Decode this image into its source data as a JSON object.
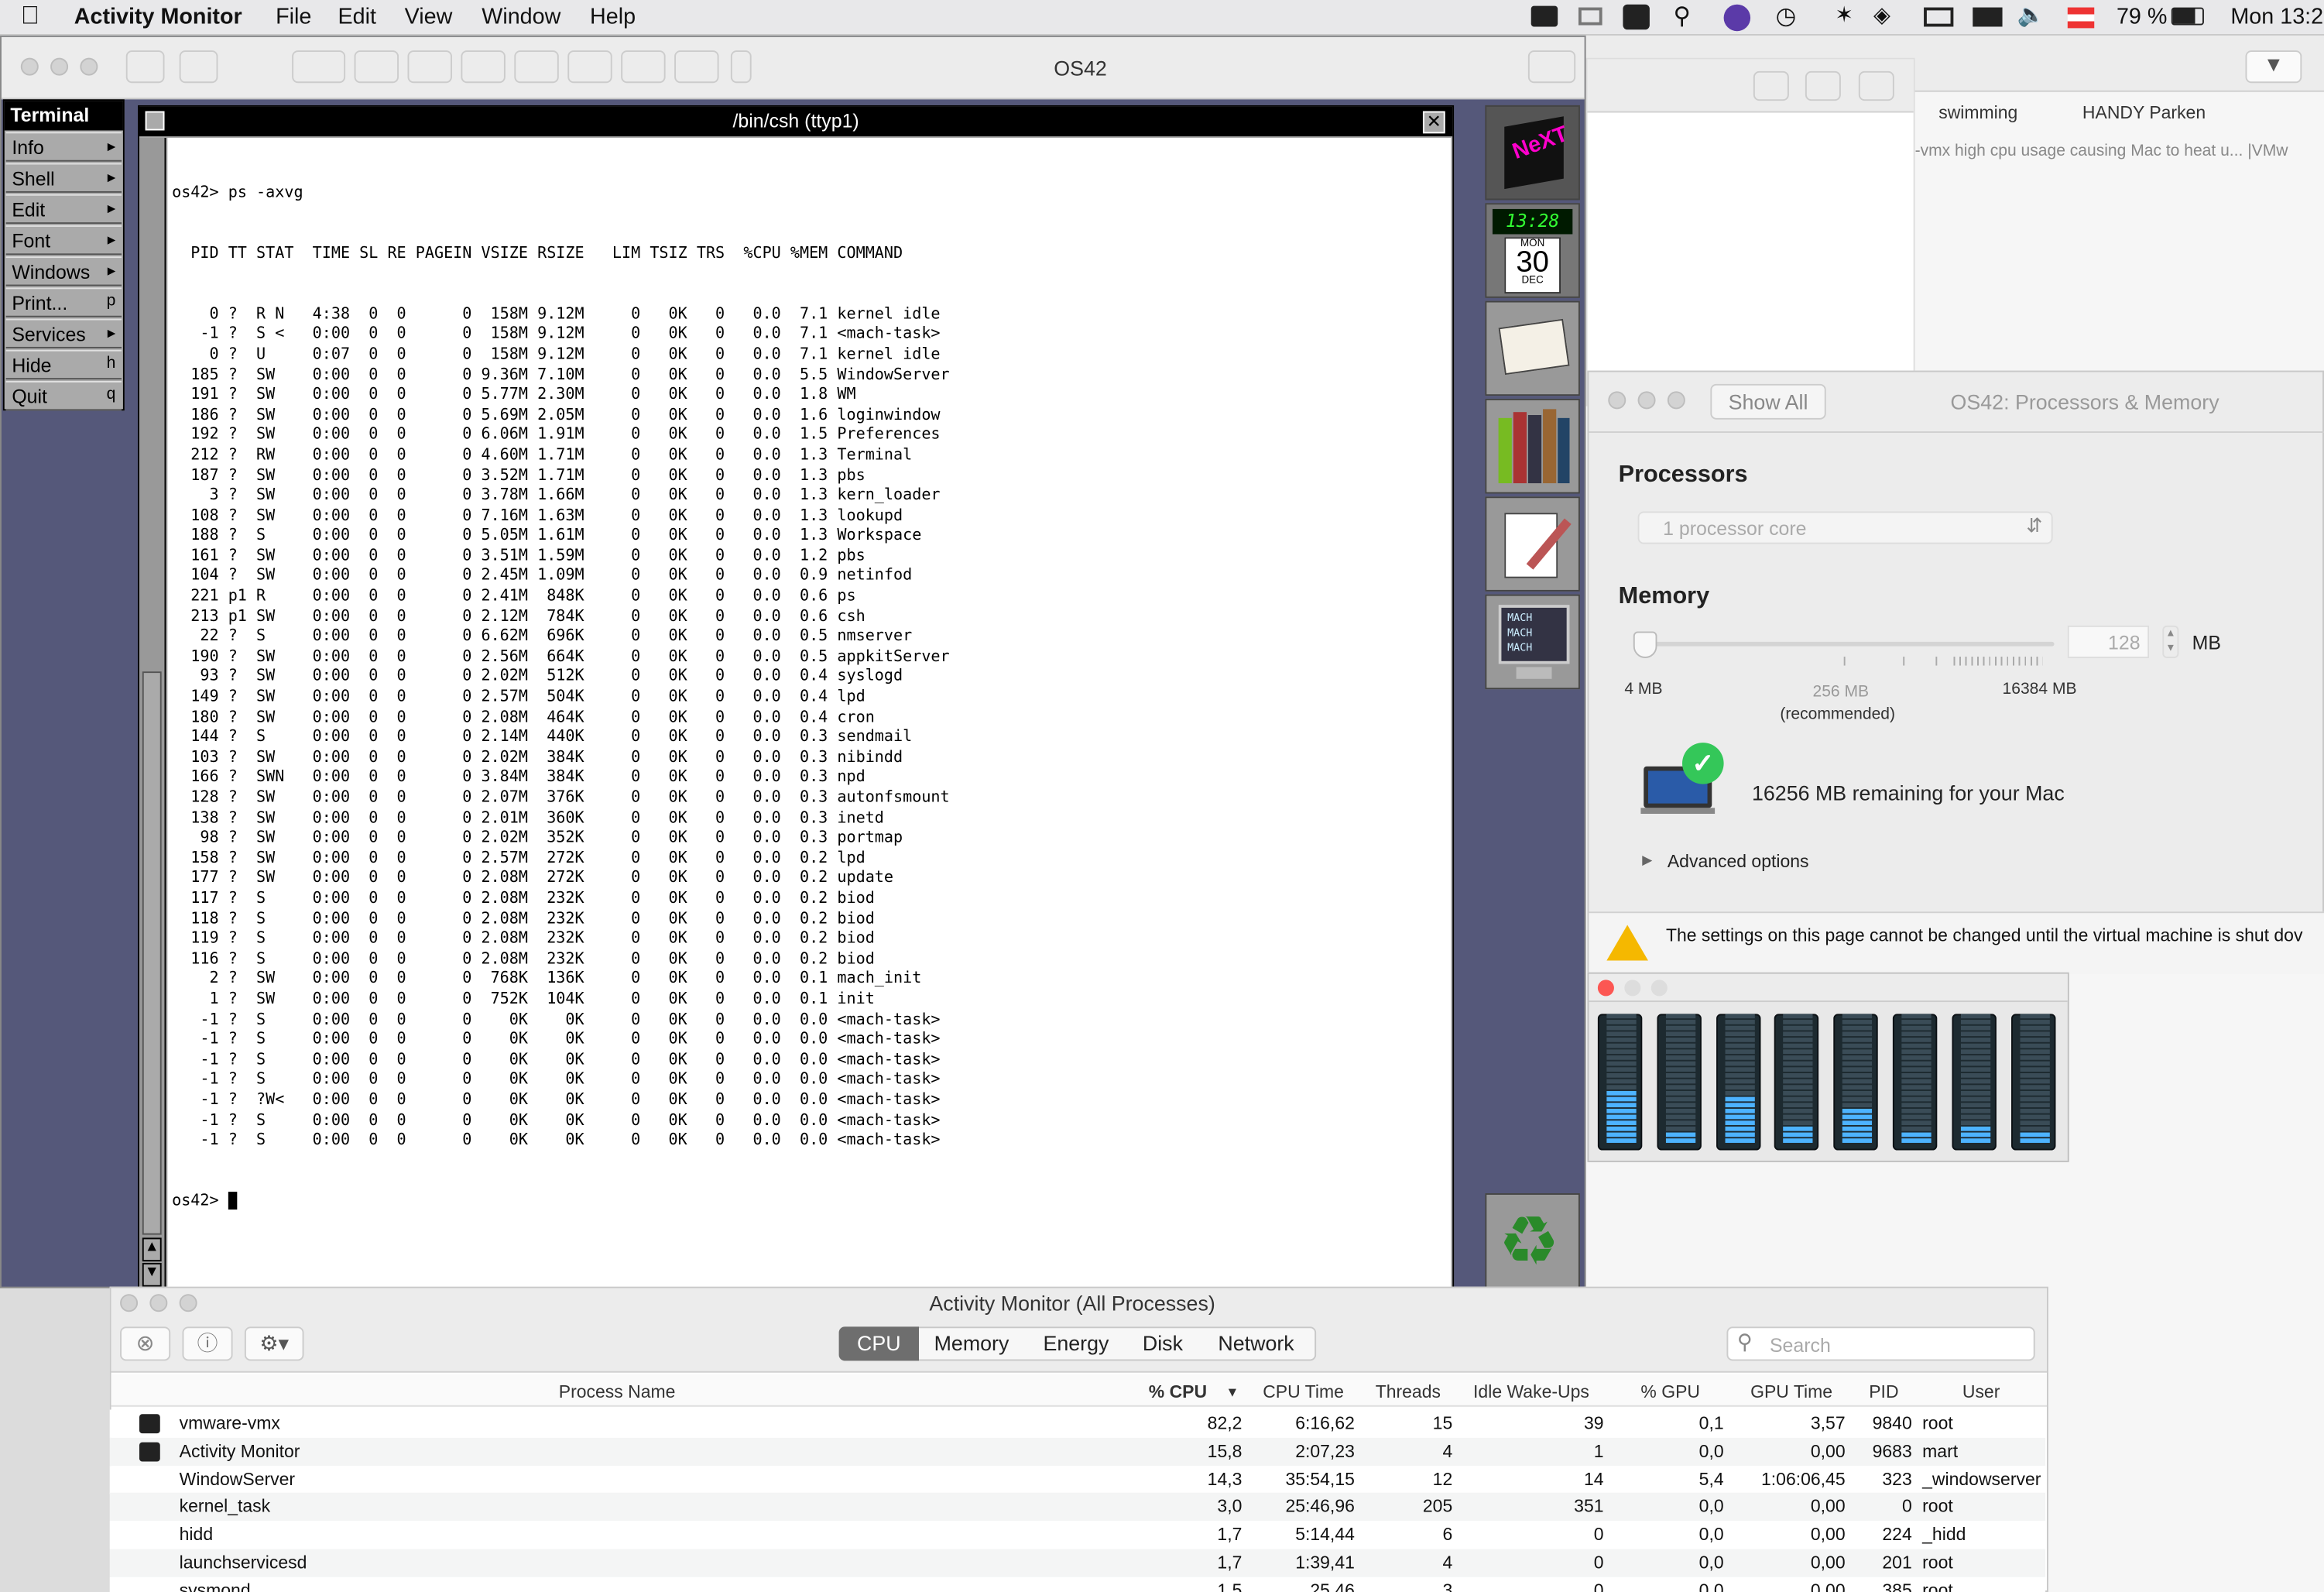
{
  "menubar": {
    "app": "Activity Monitor",
    "items": [
      "File",
      "Edit",
      "View",
      "Window",
      "Help"
    ],
    "battery": "79 %",
    "clock": "Mon 13:2"
  },
  "vm_window": {
    "title": "OS42"
  },
  "browser_bg": {
    "tab1": "swimming",
    "tab2": "HANDY Parken",
    "snippet": "-vmx high cpu usage causing Mac to heat u... |VMw"
  },
  "next_menu": {
    "title": "Terminal",
    "items": [
      {
        "label": "Info",
        "key": "▸"
      },
      {
        "label": "Shell",
        "key": "▸"
      },
      {
        "label": "Edit",
        "key": "▸"
      },
      {
        "label": "Font",
        "key": "▸"
      },
      {
        "label": "Windows",
        "key": "▸"
      },
      {
        "label": "Print...",
        "key": "p"
      },
      {
        "label": "Services",
        "key": "▸"
      },
      {
        "label": "Hide",
        "key": "h"
      },
      {
        "label": "Quit",
        "key": "q"
      }
    ]
  },
  "terminal": {
    "title": "/bin/csh (ttyp1)",
    "prompt": "os42>",
    "command": "ps -axvg",
    "header": "  PID TT STAT  TIME SL RE PAGEIN VSIZE RSIZE   LIM TSIZ TRS  %CPU %MEM COMMAND",
    "lines": [
      "    0 ?  R N   4:38  0  0      0  158M 9.12M     0   0K   0   0.0  7.1 kernel idle",
      "   -1 ?  S <   0:00  0  0      0  158M 9.12M     0   0K   0   0.0  7.1 <mach-task>",
      "    0 ?  U     0:07  0  0      0  158M 9.12M     0   0K   0   0.0  7.1 kernel idle",
      "  185 ?  SW    0:00  0  0      0 9.36M 7.10M     0   0K   0   0.0  5.5 WindowServer",
      "  191 ?  SW    0:00  0  0      0 5.77M 2.30M     0   0K   0   0.0  1.8 WM",
      "  186 ?  SW    0:00  0  0      0 5.69M 2.05M     0   0K   0   0.0  1.6 loginwindow",
      "  192 ?  SW    0:00  0  0      0 6.06M 1.91M     0   0K   0   0.0  1.5 Preferences",
      "  212 ?  RW    0:00  0  0      0 4.60M 1.71M     0   0K   0   0.0  1.3 Terminal",
      "  187 ?  SW    0:00  0  0      0 3.52M 1.71M     0   0K   0   0.0  1.3 pbs",
      "    3 ?  SW    0:00  0  0      0 3.78M 1.66M     0   0K   0   0.0  1.3 kern_loader",
      "  108 ?  SW    0:00  0  0      0 7.16M 1.63M     0   0K   0   0.0  1.3 lookupd",
      "  188 ?  S     0:00  0  0      0 5.05M 1.61M     0   0K   0   0.0  1.3 Workspace",
      "  161 ?  SW    0:00  0  0      0 3.51M 1.59M     0   0K   0   0.0  1.2 pbs",
      "  104 ?  SW    0:00  0  0      0 2.45M 1.09M     0   0K   0   0.0  0.9 netinfod",
      "  221 p1 R     0:00  0  0      0 2.41M  848K     0   0K   0   0.0  0.6 ps",
      "  213 p1 SW    0:00  0  0      0 2.12M  784K     0   0K   0   0.0  0.6 csh",
      "   22 ?  S     0:00  0  0      0 6.62M  696K     0   0K   0   0.0  0.5 nmserver",
      "  190 ?  SW    0:00  0  0      0 2.56M  664K     0   0K   0   0.0  0.5 appkitServer",
      "   93 ?  SW    0:00  0  0      0 2.02M  512K     0   0K   0   0.0  0.4 syslogd",
      "  149 ?  SW    0:00  0  0      0 2.57M  504K     0   0K   0   0.0  0.4 lpd",
      "  180 ?  SW    0:00  0  0      0 2.08M  464K     0   0K   0   0.0  0.4 cron",
      "  144 ?  S     0:00  0  0      0 2.14M  440K     0   0K   0   0.0  0.3 sendmail",
      "  103 ?  SW    0:00  0  0      0 2.02M  384K     0   0K   0   0.0  0.3 nibindd",
      "  166 ?  SWN   0:00  0  0      0 3.84M  384K     0   0K   0   0.0  0.3 npd",
      "  128 ?  SW    0:00  0  0      0 2.07M  376K     0   0K   0   0.0  0.3 autonfsmount",
      "  138 ?  SW    0:00  0  0      0 2.01M  360K     0   0K   0   0.0  0.3 inetd",
      "   98 ?  SW    0:00  0  0      0 2.02M  352K     0   0K   0   0.0  0.3 portmap",
      "  158 ?  SW    0:00  0  0      0 2.57M  272K     0   0K   0   0.0  0.2 lpd",
      "  177 ?  SW    0:00  0  0      0 2.08M  272K     0   0K   0   0.0  0.2 update",
      "  117 ?  S     0:00  0  0      0 2.08M  232K     0   0K   0   0.0  0.2 biod",
      "  118 ?  S     0:00  0  0      0 2.08M  232K     0   0K   0   0.0  0.2 biod",
      "  119 ?  S     0:00  0  0      0 2.08M  232K     0   0K   0   0.0  0.2 biod",
      "  116 ?  S     0:00  0  0      0 2.08M  232K     0   0K   0   0.0  0.2 biod",
      "    2 ?  SW    0:00  0  0      0  768K  136K     0   0K   0   0.0  0.1 mach_init",
      "    1 ?  SW    0:00  0  0      0  752K  104K     0   0K   0   0.0  0.1 init",
      "   -1 ?  S     0:00  0  0      0    0K    0K     0   0K   0   0.0  0.0 <mach-task>",
      "   -1 ?  S     0:00  0  0      0    0K    0K     0   0K   0   0.0  0.0 <mach-task>",
      "   -1 ?  S     0:00  0  0      0    0K    0K     0   0K   0   0.0  0.0 <mach-task>",
      "   -1 ?  S     0:00  0  0      0    0K    0K     0   0K   0   0.0  0.0 <mach-task>",
      "   -1 ?  ?W<   0:00  0  0      0    0K    0K     0   0K   0   0.0  0.0 <mach-task>",
      "   -1 ?  S     0:00  0  0      0    0K    0K     0   0K   0   0.0  0.0 <mach-task>",
      "   -1 ?  S     0:00  0  0      0    0K    0K     0   0K   0   0.0  0.0 <mach-task>"
    ]
  },
  "dock": {
    "clock_time": "13:28",
    "day": "MON",
    "date": "30",
    "month": "DEC",
    "mach": [
      "MACH",
      "MACH",
      "MACH"
    ]
  },
  "settings": {
    "title": "OS42: Processors & Memory",
    "show_all": "Show All",
    "processors_heading": "Processors",
    "processor_value": "1 processor core",
    "memory_heading": "Memory",
    "memory_value": "128",
    "memory_unit": "MB",
    "mem_min": "4 MB",
    "mem_rec": "256 MB",
    "mem_rec_note": "(recommended)",
    "mem_max": "16384 MB",
    "remaining": "16256 MB remaining for your Mac",
    "advanced": "Advanced options",
    "warning": "The settings on this page cannot be changed until the virtual machine is shut dov",
    "slider_fraction": 0.0
  },
  "cpu_meters": {
    "levels": [
      0.4,
      0.1,
      0.35,
      0.15,
      0.25,
      0.1,
      0.15,
      0.1
    ]
  },
  "activity": {
    "title": "Activity Monitor (All Processes)",
    "tabs": [
      "CPU",
      "Memory",
      "Energy",
      "Disk",
      "Network"
    ],
    "active_tab": "CPU",
    "search_placeholder": "Search",
    "columns": [
      "Process Name",
      "% CPU",
      "CPU Time",
      "Threads",
      "Idle Wake-Ups",
      "% GPU",
      "GPU Time",
      "PID",
      "User"
    ],
    "rows": [
      [
        "vmware-vmx",
        "82,2",
        "6:16,62",
        "15",
        "39",
        "0,1",
        "3,57",
        "9840",
        "root"
      ],
      [
        "Activity Monitor",
        "15,8",
        "2:07,23",
        "4",
        "1",
        "0,0",
        "0,00",
        "9683",
        "mart"
      ],
      [
        "WindowServer",
        "14,3",
        "35:54,15",
        "12",
        "14",
        "5,4",
        "1:06:06,45",
        "323",
        "_windowserver"
      ],
      [
        "kernel_task",
        "3,0",
        "25:46,96",
        "205",
        "351",
        "0,0",
        "0,00",
        "0",
        "root"
      ],
      [
        "hidd",
        "1,7",
        "5:14,44",
        "6",
        "0",
        "0,0",
        "0,00",
        "224",
        "_hidd"
      ],
      [
        "launchservicesd",
        "1,7",
        "1:39,41",
        "4",
        "0",
        "0,0",
        "0,00",
        "201",
        "root"
      ],
      [
        "sysmond",
        "1,5",
        "25,46",
        "3",
        "0",
        "0,0",
        "0,00",
        "385",
        "root"
      ]
    ]
  },
  "colors": {
    "next_bg": "#55587a",
    "accent": "#4db3ff",
    "check": "#34c759"
  }
}
